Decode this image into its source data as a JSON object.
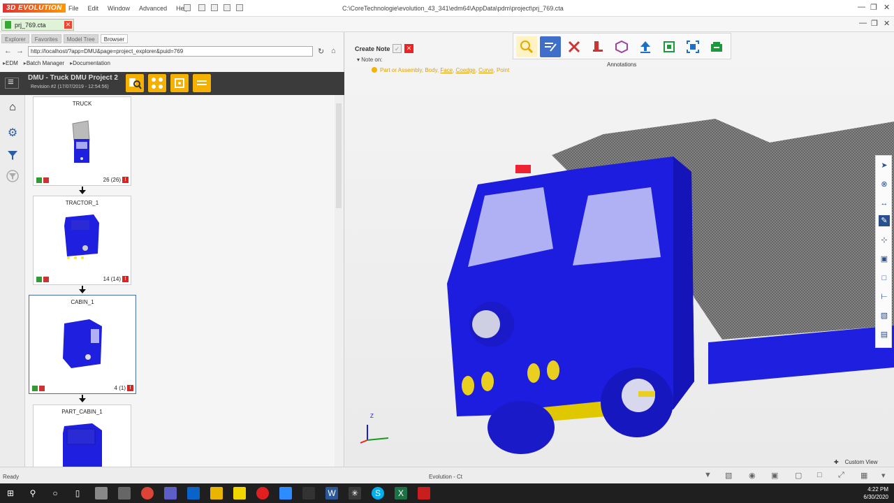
{
  "app": {
    "logo": "3D EVOLUTION",
    "menu": [
      "File",
      "Edit",
      "Window",
      "Advanced",
      "Help"
    ],
    "window_path": "C:\\CoreTechnologie\\evolution_43_341\\edm64\\AppData\\pdm\\project\\prj_769.cta",
    "window_controls": [
      "—",
      "❐",
      "✕"
    ]
  },
  "document_tab": {
    "label": "prj_769.cta",
    "close": "✕"
  },
  "left_panel": {
    "tabs": [
      "Explorer",
      "Favorites",
      "Model Tree",
      "Browser"
    ],
    "active_tab": "Browser",
    "url": "http://localhost/?app=DMU&page=project_explorer&puid=769",
    "breadcrumbs": [
      "EDM",
      "Batch Manager",
      "Documentation"
    ],
    "project_title": "DMU - Truck DMU Project 2",
    "revision": "Revision #2 (17/07/2019 - 12:54:56)"
  },
  "tree": {
    "nodes": [
      {
        "title": "TRUCK",
        "count": "26 (26)"
      },
      {
        "title": "TRACTOR_1",
        "count": "14 (14)"
      },
      {
        "title": "CABIN_1",
        "count": "4 (1)"
      },
      {
        "title": "PART_CABIN_1",
        "count": ""
      }
    ]
  },
  "viewport": {
    "note_title": "Create Note",
    "note_on": "Note on:",
    "note_filter": {
      "lead": "Part or Assembly, Body, ",
      "face": "Face",
      "edge": "Coedge",
      "curve": "Curve",
      "point": "Point"
    },
    "annotations_label": "Annotations",
    "custom_view": "Custom View",
    "axis": {
      "z": "Z"
    }
  },
  "status": {
    "left": "Ready",
    "center": "Evolution - Ct"
  },
  "taskbar": {
    "time": "4:22 PM",
    "date": "6/30/2020"
  },
  "colors": {
    "truck_blue": "#1f1fe0",
    "accent_orange": "#f2b400",
    "header_dark": "#3b3b3b",
    "selection": "#4a6ea8"
  },
  "icons": {
    "annotation_toolbar": [
      "search-icon",
      "note-edit-icon",
      "tools-icon",
      "weld-icon",
      "box-icon",
      "upload-icon",
      "frame-icon",
      "fit-icon",
      "export-icon"
    ],
    "right_toolbar": [
      "pointer-icon",
      "circle-x-icon",
      "dimension-icon",
      "note-icon",
      "datum-icon",
      "cube-icon",
      "label-icon",
      "axis-icon",
      "sheet-icon",
      "layers-icon"
    ]
  }
}
